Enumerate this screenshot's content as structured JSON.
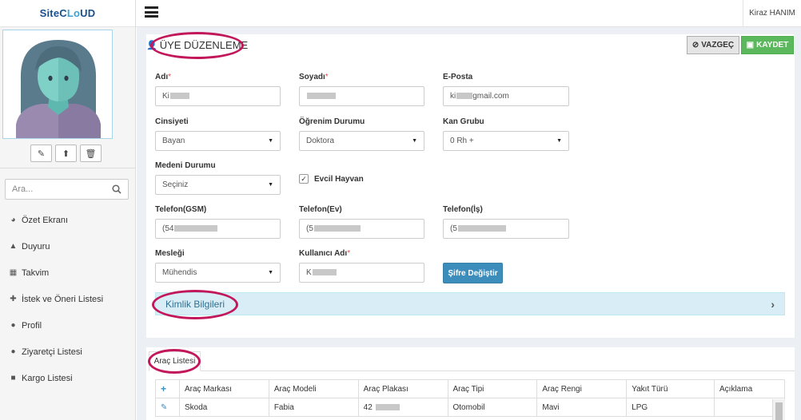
{
  "brand": {
    "logo_a": "SiteC",
    "logo_b": "L",
    "logo_c": "o",
    "logo_d": "UD"
  },
  "topbar": {
    "user_name": "Kiraz HANIM"
  },
  "sidebar": {
    "search_placeholder": "Ara...",
    "items": [
      {
        "label": "Özet Ekranı",
        "icon": "dashboard-icon"
      },
      {
        "label": "Duyuru",
        "icon": "bell-icon"
      },
      {
        "label": "Takvim",
        "icon": "calendar-icon"
      },
      {
        "label": "İstek ve Öneri Listesi",
        "icon": "puzzle-icon"
      },
      {
        "label": "Profil",
        "icon": "users-icon"
      },
      {
        "label": "Ziyaretçi Listesi",
        "icon": "users-icon"
      },
      {
        "label": "Kargo Listesi",
        "icon": "truck-icon"
      }
    ]
  },
  "form": {
    "title": "ÜYE DÜZENLEME",
    "cancel_label": "VAZGEÇ",
    "save_label": "KAYDET",
    "labels": {
      "ad": "Adı",
      "soyad": "Soyadı",
      "eposta": "E-Posta",
      "cinsiyet": "Cinsiyeti",
      "ogrenim": "Öğrenim Durumu",
      "kan": "Kan Grubu",
      "medeni": "Medeni Durumu",
      "evcil": "Evcil Hayvan",
      "gsm": "Telefon(GSM)",
      "ev": "Telefon(Ev)",
      "is": "Telefon(İş)",
      "meslek": "Mesleği",
      "kullanici": "Kullanıcı Adı",
      "required_mark": "*"
    },
    "values": {
      "ad": "Ki",
      "soyad": "",
      "eposta_a": "ki",
      "eposta_b": "gmail.com",
      "cinsiyet": "Bayan",
      "ogrenim": "Doktora",
      "kan": "0 Rh +",
      "medeni": "Seçiniz",
      "gsm": "(54",
      "ev": "(5",
      "is": "(5",
      "meslek": "Mühendis",
      "kullanici": "K",
      "evcil_checked": true
    },
    "password_button": "Şifre Değiştir",
    "identity_section": "Kimlik Bilgileri"
  },
  "cars": {
    "tab_label": "Araç Listesi",
    "headers": [
      "Araç Markası",
      "Araç Modeli",
      "Araç Plakası",
      "Araç Tipi",
      "Araç Rengi",
      "Yakıt Türü",
      "Açıklama"
    ],
    "rows": [
      {
        "marka": "Skoda",
        "model": "Fabia",
        "plaka": "42",
        "tip": "Otomobil",
        "renk": "Mavi",
        "yakit": "LPG",
        "aciklama": ""
      }
    ]
  },
  "colors": {
    "accent": "#3c8dbc",
    "save": "#5cb85c",
    "annotation": "#c2185b",
    "info_bg": "#d9edf7"
  }
}
